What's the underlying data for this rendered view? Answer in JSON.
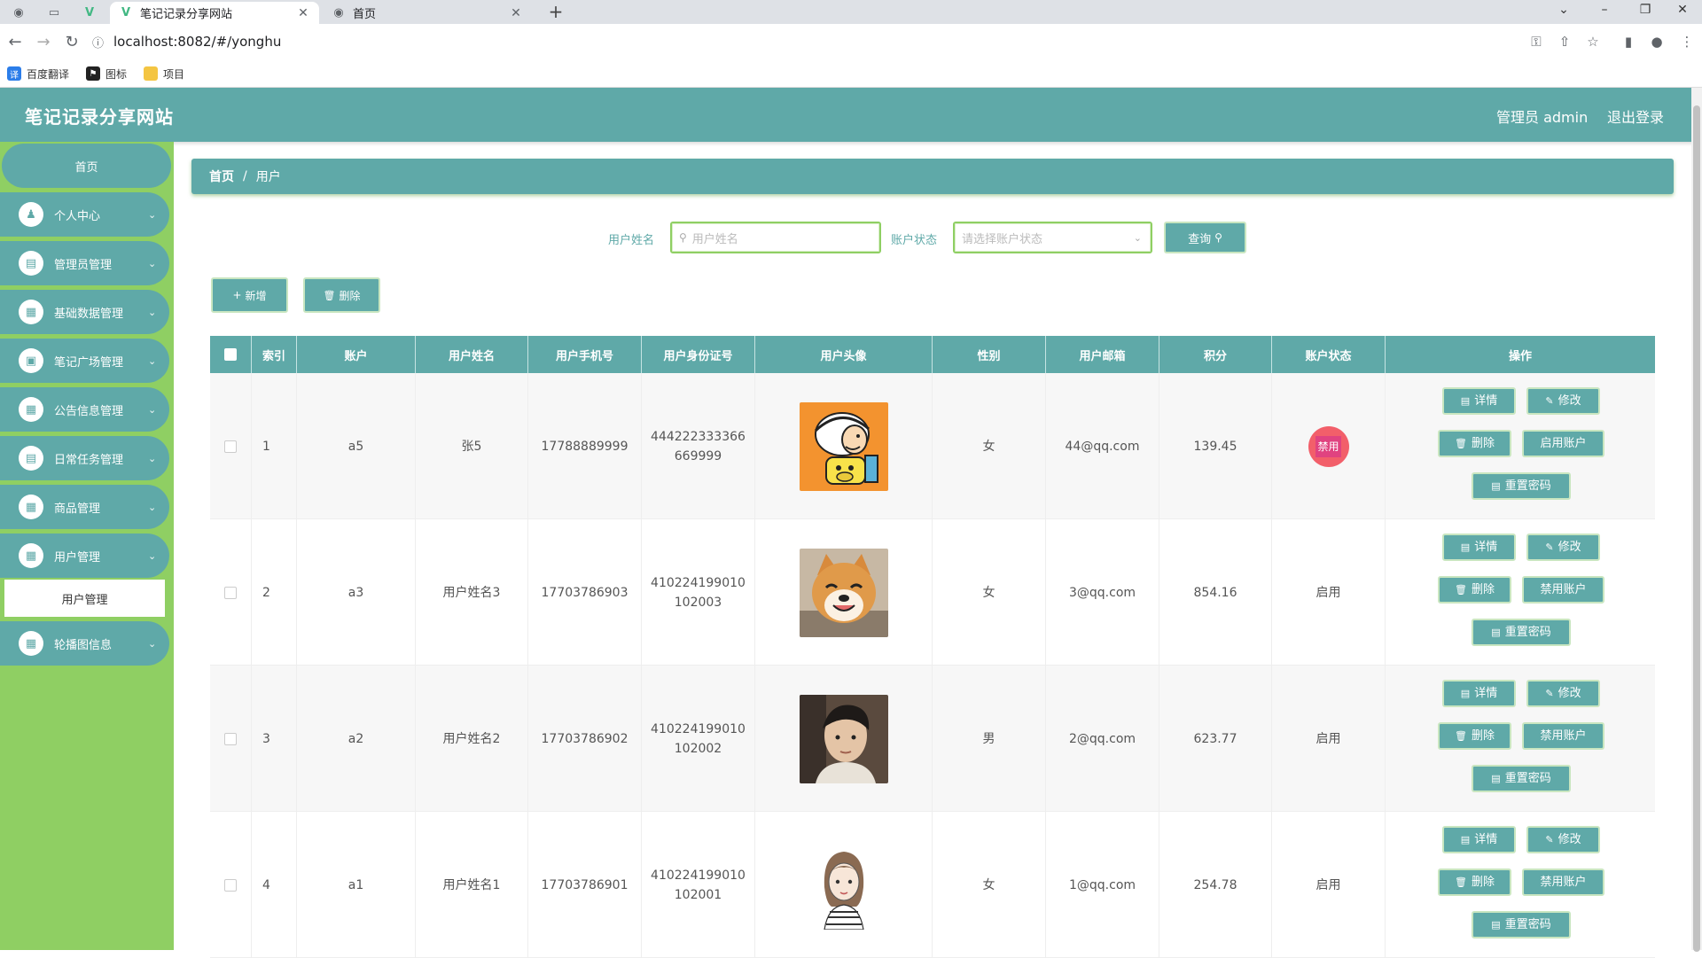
{
  "browser": {
    "tabs": [
      {
        "title": "笔记记录分享网站",
        "active": true
      },
      {
        "title": "首页",
        "active": false
      }
    ],
    "url": "localhost:8082/#/yonghu",
    "bookmarks": [
      "百度翻译",
      "图标",
      "项目"
    ]
  },
  "header": {
    "title": "笔记记录分享网站",
    "admin": "管理员 admin",
    "logout": "退出登录"
  },
  "sidebar": {
    "home": "首页",
    "items": [
      {
        "label": "个人中心",
        "icon": "user-icon"
      },
      {
        "label": "管理员管理",
        "icon": "chart-icon"
      },
      {
        "label": "基础数据管理",
        "icon": "grid-icon"
      },
      {
        "label": "笔记广场管理",
        "icon": "box-icon"
      },
      {
        "label": "公告信息管理",
        "icon": "grid-icon"
      },
      {
        "label": "日常任务管理",
        "icon": "clipboard-icon"
      },
      {
        "label": "商品管理",
        "icon": "grid-icon"
      },
      {
        "label": "用户管理",
        "icon": "grid-icon"
      },
      {
        "label": "轮播图信息",
        "icon": "grid-icon"
      }
    ],
    "sub_active": "用户管理"
  },
  "breadcrumb": {
    "home": "首页",
    "sep": "/",
    "current": "用户"
  },
  "search": {
    "name_label": "用户姓名",
    "name_placeholder": "用户姓名",
    "status_label": "账户状态",
    "status_placeholder": "请选择账户状态",
    "query": "查询"
  },
  "toolbar": {
    "add": "新增",
    "delete": "删除"
  },
  "table": {
    "headers": [
      "索引",
      "账户",
      "用户姓名",
      "用户手机号",
      "用户身份证号",
      "用户头像",
      "性别",
      "用户邮箱",
      "积分",
      "账户状态",
      "操作"
    ],
    "rows": [
      {
        "index": "1",
        "account": "a5",
        "name": "张5",
        "phone": "17788889999",
        "id1": "444222333366",
        "id2": "669999",
        "avatar": "cartoon-boy",
        "gender": "女",
        "email": "44@qq.com",
        "points": "139.45",
        "status": "禁用",
        "toggle": "启用账户"
      },
      {
        "index": "2",
        "account": "a3",
        "name": "用户姓名3",
        "phone": "17703786903",
        "id1": "410224199010",
        "id2": "102003",
        "avatar": "shiba-dog",
        "gender": "女",
        "email": "3@qq.com",
        "points": "854.16",
        "status": "启用",
        "toggle": "禁用账户"
      },
      {
        "index": "3",
        "account": "a2",
        "name": "用户姓名2",
        "phone": "17703786902",
        "id1": "410224199010",
        "id2": "102002",
        "avatar": "young-man",
        "gender": "男",
        "email": "2@qq.com",
        "points": "623.77",
        "status": "启用",
        "toggle": "禁用账户"
      },
      {
        "index": "4",
        "account": "a1",
        "name": "用户姓名1",
        "phone": "17703786901",
        "id1": "410224199010",
        "id2": "102001",
        "avatar": "sketch-girl",
        "gender": "女",
        "email": "1@qq.com",
        "points": "254.78",
        "status": "启用",
        "toggle": "禁用账户"
      }
    ],
    "actions": {
      "detail": "详情",
      "edit": "修改",
      "delete": "删除",
      "reset": "重置密码"
    }
  },
  "colors": {
    "primary": "#5fa9a8",
    "sidebar": "#8fcf63",
    "danger": "#f25f6a"
  }
}
